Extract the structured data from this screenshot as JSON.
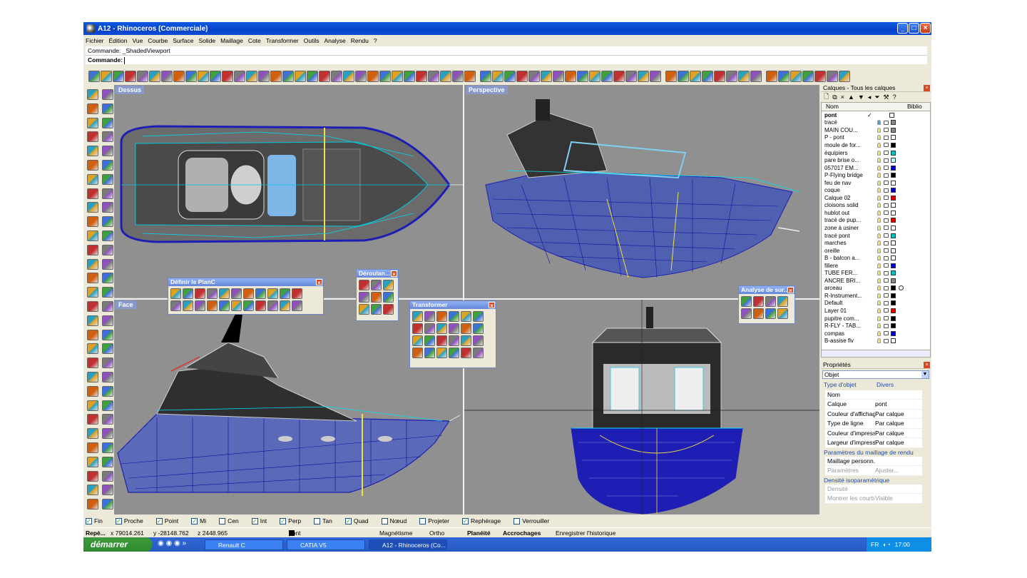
{
  "window": {
    "title": "A12 - Rhinoceros (Commerciale)",
    "minimize": "_",
    "maximize": "□",
    "close": "×"
  },
  "menu": [
    "Fichier",
    "Édition",
    "Vue",
    "Courbe",
    "Surface",
    "Solide",
    "Maillage",
    "Cote",
    "Transformer",
    "Outils",
    "Analyse",
    "Rendu",
    "?"
  ],
  "command": {
    "history": "Commande: _ShadedViewport",
    "prompt": "Commande:"
  },
  "viewports": {
    "top_left": "Dessus",
    "top_right": "Perspective",
    "bottom_left": "Face",
    "axis_x": "x",
    "axis_y": "y",
    "axis_z": "z"
  },
  "panels": {
    "plan": "Définir le PlanC",
    "deroul": "Déroulan...",
    "transform": "Transformer",
    "analyse": "Analyse de sur..."
  },
  "layers": {
    "title": "Calques - Tous les calques",
    "col_name": "Nom",
    "col_lib": "Biblio",
    "items": [
      {
        "name": "pont",
        "current": "✓",
        "color": "#ffffff",
        "bulb": "none"
      },
      {
        "name": "tracé",
        "color": "#888888",
        "bulb": "blue"
      },
      {
        "name": "MAIN COU...",
        "color": "#888888",
        "bulb": "yellow"
      },
      {
        "name": "P - pont",
        "color": "#ffffff",
        "bulb": "yellow"
      },
      {
        "name": "moule de for...",
        "color": "#000000",
        "bulb": "yellow"
      },
      {
        "name": "équipiers",
        "color": "#00c0c0",
        "bulb": "yellow"
      },
      {
        "name": "pare brise o...",
        "color": "#c0ffff",
        "bulb": "yellow"
      },
      {
        "name": "057017 EM...",
        "color": "#0000c0",
        "bulb": "yellow"
      },
      {
        "name": "P-Flying bridge",
        "color": "#000000",
        "bulb": "yellow"
      },
      {
        "name": "feu de nav",
        "color": "#ffffff",
        "bulb": "yellow"
      },
      {
        "name": "coque",
        "color": "#0000c0",
        "bulb": "yellow"
      },
      {
        "name": "Calque 02",
        "color": "#e00000",
        "bulb": "yellow"
      },
      {
        "name": "cloisons solid",
        "color": "#ffffff",
        "bulb": "yellow"
      },
      {
        "name": "hublot out",
        "color": "#ffffff",
        "bulb": "yellow"
      },
      {
        "name": "tracé de pup...",
        "color": "#e00000",
        "bulb": "yellow"
      },
      {
        "name": "zone à usiner",
        "color": "#ffffff",
        "bulb": "yellow"
      },
      {
        "name": "tracé pont",
        "color": "#00c0c0",
        "bulb": "yellow"
      },
      {
        "name": "marches",
        "color": "#ffffff",
        "bulb": "yellow"
      },
      {
        "name": "oreille",
        "color": "#ffffff",
        "bulb": "yellow"
      },
      {
        "name": "B - balcon a...",
        "color": "#ffffff",
        "bulb": "yellow"
      },
      {
        "name": "filiere",
        "color": "#0000c0",
        "bulb": "yellow"
      },
      {
        "name": "TUBE FER...",
        "color": "#00c0c0",
        "bulb": "yellow"
      },
      {
        "name": "ANCRE BRI...",
        "color": "#888888",
        "bulb": "yellow"
      },
      {
        "name": "arceau",
        "color": "#000000",
        "bulb": "yellow",
        "circle": true
      },
      {
        "name": "R-Instrument...",
        "color": "#000000",
        "bulb": "yellow"
      },
      {
        "name": "Default",
        "color": "#000000",
        "bulb": "yellow"
      },
      {
        "name": "Layer 01",
        "color": "#e00000",
        "bulb": "yellow"
      },
      {
        "name": "pupitre com...",
        "color": "#000000",
        "bulb": "yellow"
      },
      {
        "name": "R-FLY - TAB...",
        "color": "#000000",
        "bulb": "yellow"
      },
      {
        "name": "compas",
        "color": "#0000c0",
        "bulb": "yellow"
      },
      {
        "name": "B-assise flv",
        "color": "#ffffff",
        "bulb": "yellow"
      }
    ]
  },
  "properties": {
    "title": "Propriétés",
    "selector": "Objet",
    "type_label": "Type d'objet",
    "type_value": "Divers",
    "rows": [
      {
        "label": "Nom",
        "value": ""
      },
      {
        "label": "Calque",
        "value": "pont"
      },
      {
        "label": "Couleur d'affichage",
        "value": "Par calque"
      },
      {
        "label": "Type de ligne",
        "value": "Par calque"
      },
      {
        "label": "Couleur d'impress...",
        "value": "Par calque"
      },
      {
        "label": "Largeur d'impress...",
        "value": "Par calque"
      }
    ],
    "mesh_group": "Paramètres du maillage de rendu",
    "mesh_rows": [
      {
        "label": "Maillage personn...",
        "value": ""
      },
      {
        "label": "Paramètres",
        "value": "Ajuster..."
      }
    ],
    "iso_group": "Densité isoparamétrique",
    "iso_rows": [
      {
        "label": "Densité",
        "value": ""
      },
      {
        "label": "Montrer les courb...",
        "value": "Visible"
      }
    ]
  },
  "osnaps": [
    {
      "label": "Fin",
      "checked": true
    },
    {
      "label": "Proche",
      "checked": true
    },
    {
      "label": "Point",
      "checked": true
    },
    {
      "label": "Mi",
      "checked": true
    },
    {
      "label": "Cen",
      "checked": false
    },
    {
      "label": "Int",
      "checked": true
    },
    {
      "label": "Perp",
      "checked": true
    },
    {
      "label": "Tan",
      "checked": false
    },
    {
      "label": "Quad",
      "checked": true
    },
    {
      "label": "Nœud",
      "checked": false
    },
    {
      "label": "Projeter",
      "checked": false
    },
    {
      "label": "Rephérage",
      "checked": true
    },
    {
      "label": "Verrouiller",
      "checked": false
    }
  ],
  "status": {
    "ref": "Repè...",
    "x": "x 79014.261",
    "y": "y -28148.762",
    "z": "z 2448.965",
    "layer": "pont",
    "magnet": "Magnétisme",
    "ortho": "Ortho",
    "planar": "Planéité",
    "osnap": "Accrochages",
    "history": "Enregistrer l'historique"
  },
  "taskbar": {
    "start": "démarrer",
    "tasks": [
      "Renault C",
      "CATIA V5",
      "A12 - Rhinoceros (Co..."
    ],
    "lang": "FR",
    "time": "17:00"
  }
}
